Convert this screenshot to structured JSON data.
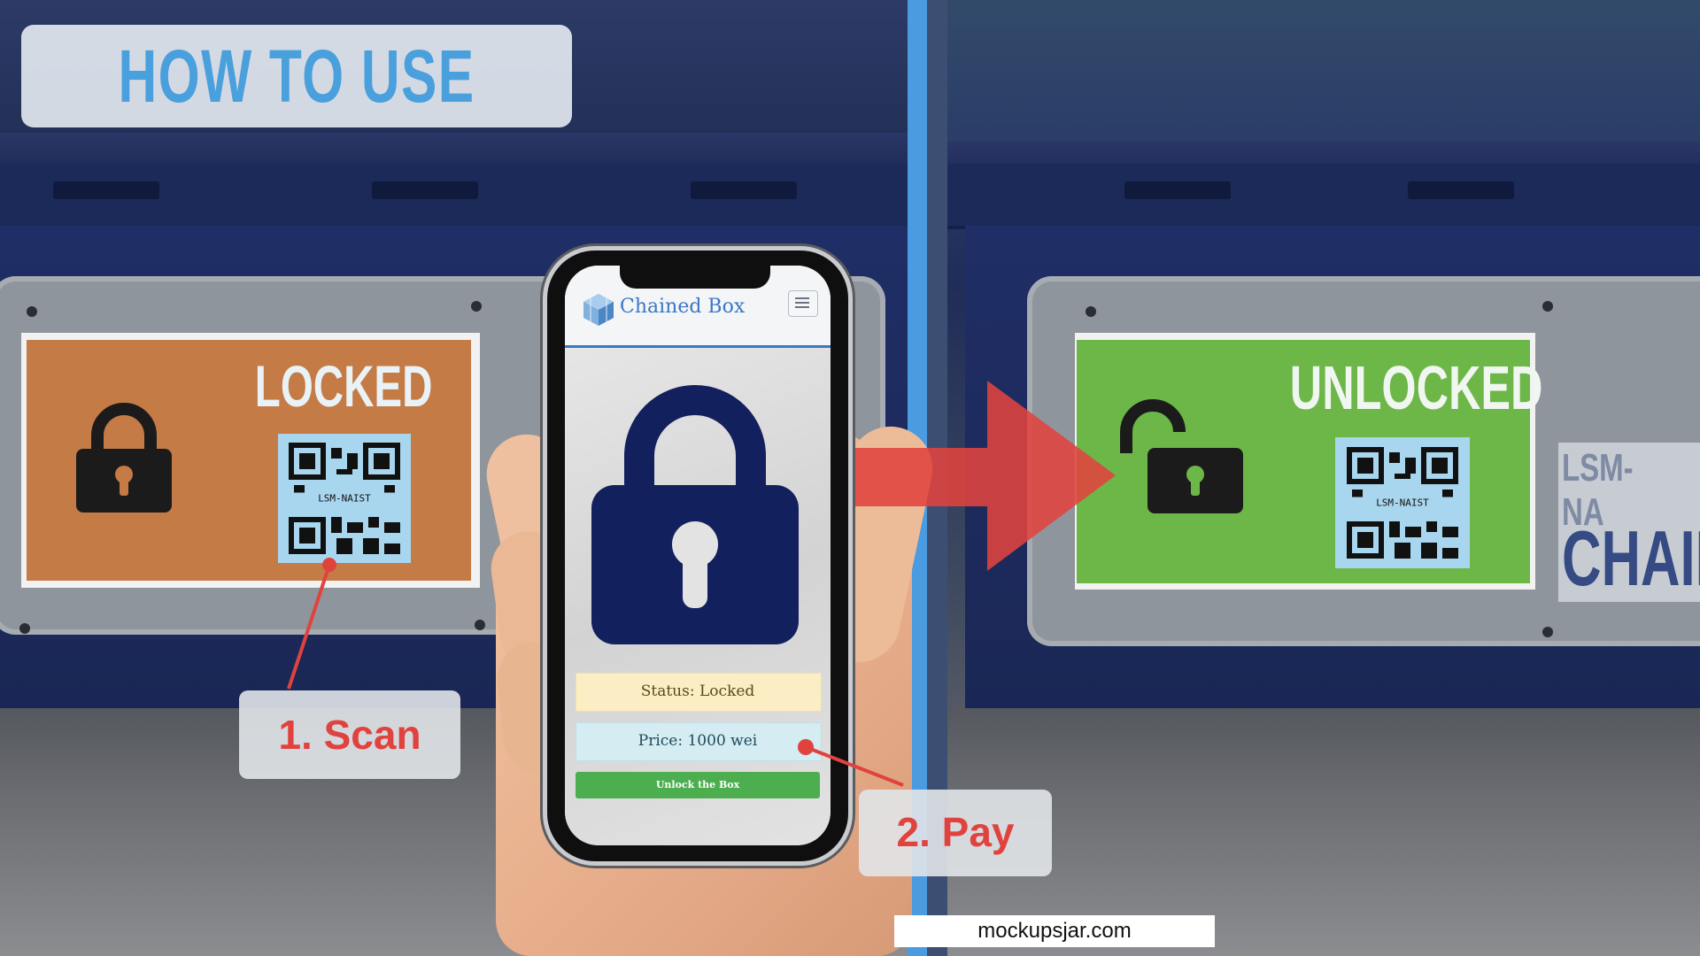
{
  "title": "HOW TO USE",
  "left_panel": {
    "status_label": "LOCKED",
    "qr_label": "LSM-NAIST"
  },
  "right_panel": {
    "status_label": "UNLOCKED",
    "qr_label": "LSM-NAIST",
    "side_code": "LSM-NA",
    "side_brand": "CHAIN"
  },
  "callouts": {
    "scan": "1. Scan",
    "pay": "2. Pay"
  },
  "phone_app": {
    "title": "Chained Box",
    "status": "Status: Locked",
    "price": "Price: 1000 wei",
    "unlock_button": "Unlock the Box"
  },
  "watermark": "mockupsjar.com",
  "colors": {
    "title_text": "#4aa0dc",
    "divider": "#4a9be0",
    "locked_panel": "#c47b45",
    "unlocked_panel": "#6db648",
    "callout_text": "#e0433e",
    "app_brand": "#3a78c4",
    "lock_icon": "#13205e",
    "unlock_button": "#4cae4f"
  },
  "icons": [
    "padlock-closed-icon",
    "padlock-open-icon",
    "qr-code-icon",
    "right-arrow-icon",
    "cube-logo-icon",
    "hamburger-menu-icon"
  ]
}
